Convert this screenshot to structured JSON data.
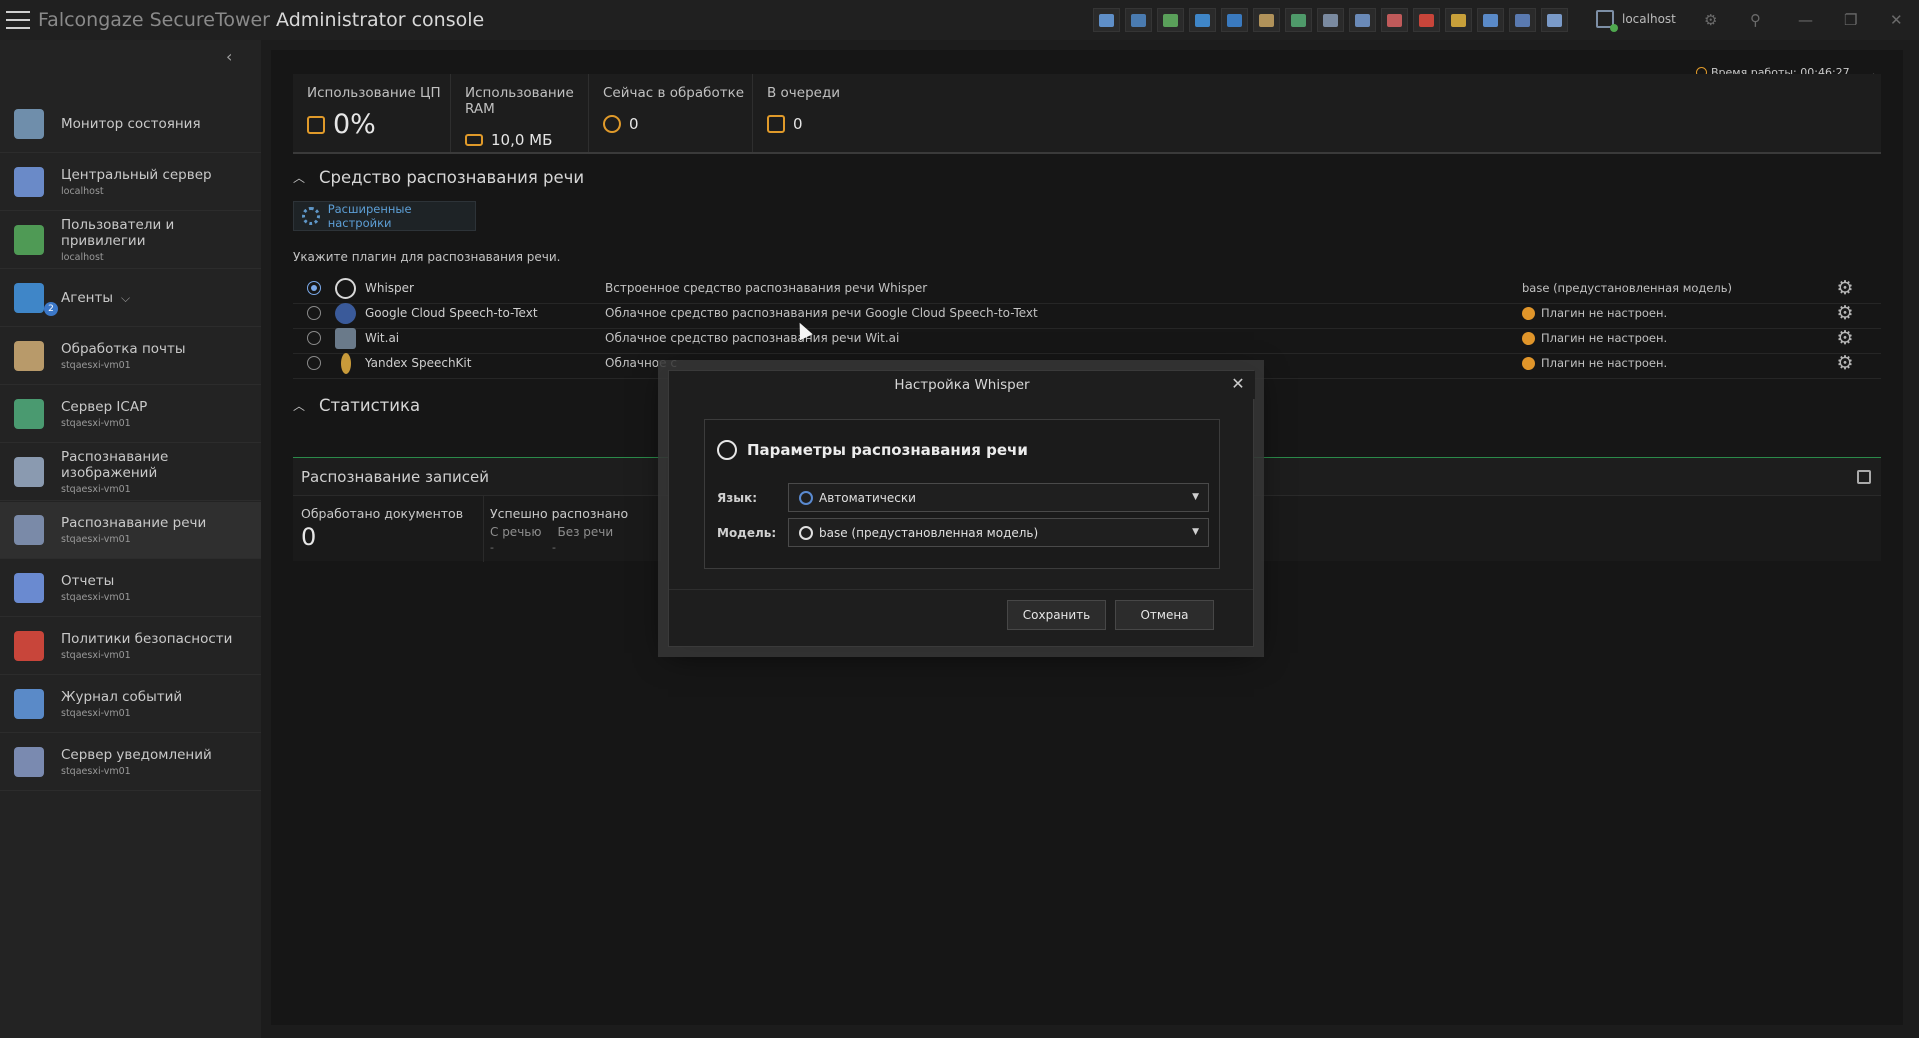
{
  "window": {
    "title_prefix": "Falcongaze SecureTower ",
    "title_main": "Administrator console",
    "server": "localhost"
  },
  "toolbar_icons": [
    {
      "name": "shield-icon",
      "color": "#5f8fc8"
    },
    {
      "name": "server-icon",
      "color": "#4a7bb0"
    },
    {
      "name": "users-icon",
      "color": "#5aa05a"
    },
    {
      "name": "agents-icon",
      "color": "#3f86c8"
    },
    {
      "name": "network-icon",
      "color": "#3a7abf"
    },
    {
      "name": "mail-icon",
      "color": "#b0925a"
    },
    {
      "name": "icap-icon",
      "color": "#4f9a6a"
    },
    {
      "name": "image-recognition-icon",
      "color": "#7a8aa0"
    },
    {
      "name": "speech-recognition-icon",
      "color": "#6a8ab8"
    },
    {
      "name": "reports-icon",
      "color": "#c05a5a"
    },
    {
      "name": "policy-icon",
      "color": "#c8453a"
    },
    {
      "name": "library-icon",
      "color": "#c8a03a"
    },
    {
      "name": "event-log-icon",
      "color": "#5a8ac8"
    },
    {
      "name": "topology-icon",
      "color": "#5a7ab0"
    },
    {
      "name": "monitor-icon",
      "color": "#7a9ac8"
    }
  ],
  "sidebar": {
    "items": [
      {
        "label": "Монитор состояния",
        "sub": "",
        "icon": "monitor-icon",
        "color": "#6f8eab"
      },
      {
        "label": "Центральный сервер",
        "sub": "localhost",
        "icon": "shield-icon",
        "color": "#6a8ac8"
      },
      {
        "label": "Пользователи и привилегии",
        "sub": "localhost",
        "icon": "users-icon",
        "color": "#4f9a55"
      },
      {
        "label": "Агенты",
        "sub": "",
        "icon": "agents-icon",
        "color": "#3f86c8",
        "badge": "2"
      },
      {
        "label": "Обработка почты",
        "sub": "stqaesxi-vm01",
        "icon": "mail-icon",
        "color": "#b89a6a"
      },
      {
        "label": "Сервер ICAP",
        "sub": "stqaesxi-vm01",
        "icon": "icap-icon",
        "color": "#4a9a70"
      },
      {
        "label": "Распознавание изображений",
        "sub": "stqaesxi-vm01",
        "icon": "image-recognition-icon",
        "color": "#8a9ab0"
      },
      {
        "label": "Распознавание речи",
        "sub": "stqaesxi-vm01",
        "icon": "speech-recognition-icon",
        "color": "#7a8aa8"
      },
      {
        "label": "Отчеты",
        "sub": "stqaesxi-vm01",
        "icon": "reports-icon",
        "color": "#6a8ad0"
      },
      {
        "label": "Политики безопасности",
        "sub": "stqaesxi-vm01",
        "icon": "policy-icon",
        "color": "#c8453a"
      },
      {
        "label": "Журнал событий",
        "sub": "stqaesxi-vm01",
        "icon": "event-log-icon",
        "color": "#5a8ac8"
      },
      {
        "label": "Сервер уведомлений",
        "sub": "stqaesxi-vm01",
        "icon": "notification-icon",
        "color": "#7a8ab0"
      }
    ]
  },
  "uptime": "Время работы: 00:46:27",
  "stats": {
    "cpu": {
      "title": "Использование ЦП",
      "value": "0%"
    },
    "ram": {
      "title": "Использование RAM",
      "value": "10,0 МБ"
    },
    "processing": {
      "title": "Сейчас в обработке",
      "value": "0"
    },
    "queue": {
      "title": "В очереди",
      "value": "0"
    }
  },
  "speech": {
    "section_title": "Средство распознавания речи",
    "advanced_label": "Расширенные настройки",
    "hint": "Укажите плагин для распознавания речи.",
    "plugins": [
      {
        "name": "Whisper",
        "desc": "Встроенное средство распознавания речи Whisper",
        "status": "base (предустановленная модель)",
        "selected": true,
        "warn": false
      },
      {
        "name": "Google Cloud Speech-to-Text",
        "desc": "Облачное средство распознавания речи Google Cloud Speech-to-Text",
        "status": "Плагин не настроен.",
        "selected": false,
        "warn": true
      },
      {
        "name": "Wit.ai",
        "desc": "Облачное средство распознавания речи Wit.ai",
        "status": "Плагин не настроен.",
        "selected": false,
        "warn": true
      },
      {
        "name": "Yandex SpeechKit",
        "desc": "Облачное с",
        "status": "Плагин не настроен.",
        "selected": false,
        "warn": true
      }
    ]
  },
  "statistics": {
    "section_title": "Статистика",
    "panel_title": "Распознавание записей",
    "processed_label": "Обработано документов",
    "processed_value": "0",
    "success_label": "Успешно распознано",
    "with_speech_label": "С речью",
    "without_speech_label": "Без речи",
    "with_speech_value": "-",
    "without_speech_value": "-"
  },
  "dialog": {
    "title": "Настройка Whisper",
    "group_title": "Параметры распознавания речи",
    "language_label": "Язык:",
    "language_value": "Автоматически",
    "model_label": "Модель:",
    "model_value": "base (предустановленная модель)",
    "save_label": "Сохранить",
    "cancel_label": "Отмена"
  }
}
